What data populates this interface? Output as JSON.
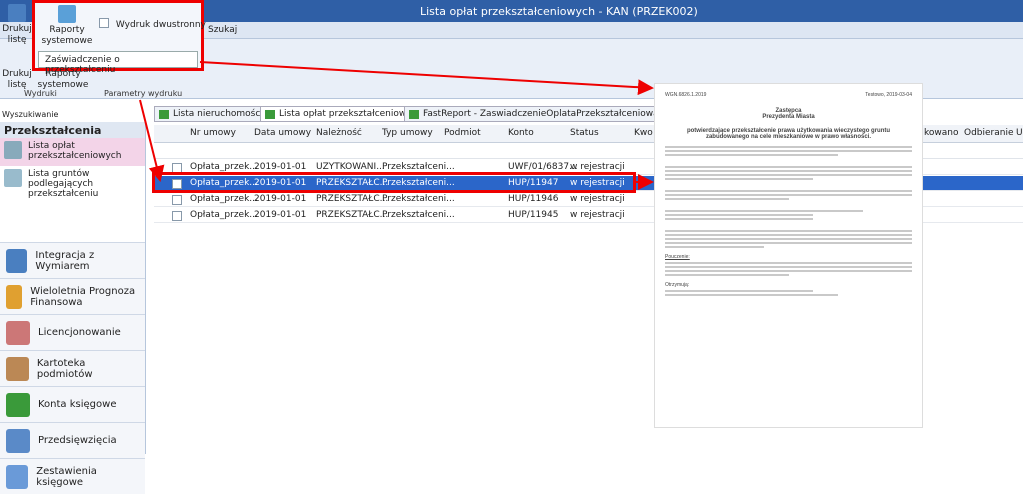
{
  "window": {
    "title": "Lista opłat przekształceniowych - KAN (PRZEK002)"
  },
  "ribbon": {
    "print_label": "Drukuj listę",
    "reports_label": "Raporty systemowe",
    "duplex_label": "Wydruk dwustronny",
    "search_tab": "Szukaj",
    "menu_item": "Zaświadczenie o przekształceniu",
    "group_print": "Wydruki",
    "group_params": "Parametry wydruku",
    "print_label2": "Drukuj listę",
    "reports_label2": "Raporty systemowe"
  },
  "sidebar": {
    "search_label": "Wyszukiwanie",
    "header": "Przekształcenia",
    "items": [
      "Lista opłat przekształceniowych",
      "Lista gruntów podlegających przekształceniu"
    ],
    "modules": [
      "Integracja z Wymiarem",
      "Wieloletnia Prognoza Finansowa",
      "Licencjonowanie",
      "Kartoteka podmiotów",
      "Konta księgowe",
      "Przedsięwzięcia",
      "Zestawienia księgowe"
    ]
  },
  "doc_tabs": [
    "Lista nieruchomości",
    "Lista opłat przekształceniowych",
    "FastReport - ZaswiadczenieOplataPrzekształceniowa.frx"
  ],
  "grid": {
    "columns": [
      "Nr umowy",
      "Data umowy",
      "Należność",
      "Typ umowy",
      "Podmiot",
      "Konto",
      "Status",
      "Kwo"
    ],
    "right_columns": [
      "kowano",
      "Odbieranie fa...",
      "U"
    ],
    "rows": [
      {
        "nr": "Opłata_przek...",
        "data": "2019-01-01",
        "nal": "UŻYTKOWANI...",
        "typ": "Przekształceni...",
        "konto": "UWF/01/6837...",
        "status": "w rejestracji"
      },
      {
        "nr": "Opłata_przek...",
        "data": "2019-01-01",
        "nal": "PRZEKSZTAŁC...",
        "typ": "Przekształceni...",
        "konto": "HUP/11947",
        "status": "w rejestracji"
      },
      {
        "nr": "Opłata_przek...",
        "data": "2019-01-01",
        "nal": "PRZEKSZTAŁC...",
        "typ": "Przekształceni...",
        "konto": "HUP/11946",
        "status": "w rejestracji"
      },
      {
        "nr": "Opłata_przek...",
        "data": "2019-01-01",
        "nal": "PRZEKSZTAŁC...",
        "typ": "Przekształceni...",
        "konto": "HUP/11945",
        "status": "w rejestracji"
      }
    ]
  },
  "document": {
    "ref": "WGN.6826.1.2019",
    "place_date": "Testowo, 2019-03-04",
    "issuer_line1": "Zastępca",
    "issuer_line2": "Prezydenta Miasta",
    "title": "potwierdzające przekształcenie prawa użytkowania wieczystego gruntu zabudowanego na cele mieszkaniowe w prawo własności.",
    "section1": "Pouczenie:",
    "section2": "Otrzymują:"
  }
}
